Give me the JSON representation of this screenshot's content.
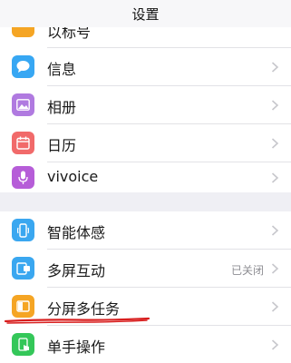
{
  "nav": {
    "title": "设置"
  },
  "group1": {
    "partial_label": "以标号",
    "items": [
      {
        "label": "信息",
        "icon": "message-icon",
        "color": "#37a7f3"
      },
      {
        "label": "相册",
        "icon": "photo-icon",
        "color": "#b07ae0"
      },
      {
        "label": "日历",
        "icon": "calendar-icon",
        "color": "#f16a6a"
      },
      {
        "label": "vivoice",
        "icon": "microphone-icon",
        "color": "#b65dd8"
      }
    ]
  },
  "group2": {
    "items": [
      {
        "label": "智能体感",
        "icon": "phone-motion-icon",
        "color": "#3aa7f0",
        "value": ""
      },
      {
        "label": "多屏互动",
        "icon": "screen-cast-icon",
        "color": "#3aa7f0",
        "value": "已关闭"
      },
      {
        "label": "分屏多任务",
        "icon": "split-screen-icon",
        "color": "#f5a524",
        "value": ""
      },
      {
        "label": "单手操作",
        "icon": "one-hand-icon",
        "color": "#34c759",
        "value": ""
      }
    ]
  },
  "colors": {
    "annotation": "#d81e1e",
    "background": "#efeff4",
    "chevron": "#c7c7cc"
  }
}
